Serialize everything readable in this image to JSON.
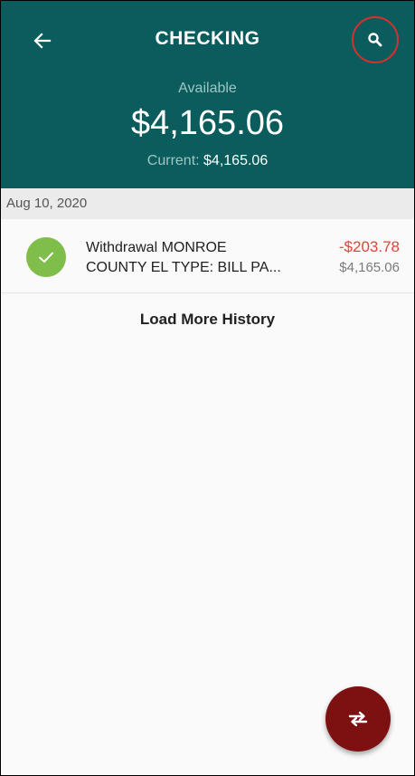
{
  "header": {
    "title": "CHECKING",
    "available_label": "Available",
    "available_balance": "$4,165.06",
    "current_label": "Current: ",
    "current_balance": "$4,165.06",
    "back_icon": "arrow-left-icon",
    "search_icon": "search-icon"
  },
  "transactions": {
    "groups": [
      {
        "date": "Aug 10, 2020",
        "items": [
          {
            "description_line1": "Withdrawal MONROE",
            "description_line2": "COUNTY EL TYPE: BILL PA...",
            "amount": "-$203.78",
            "running_balance": "$4,165.06",
            "status_icon": "check-icon"
          }
        ]
      }
    ]
  },
  "load_more_label": "Load More History",
  "fab_icon": "transfer-icon",
  "colors": {
    "header_bg": "#0b5c5c",
    "status_green": "#7fbe4a",
    "negative_amount": "#e8403a",
    "fab_bg": "#7d1010",
    "highlight_ring": "#d9302c"
  }
}
